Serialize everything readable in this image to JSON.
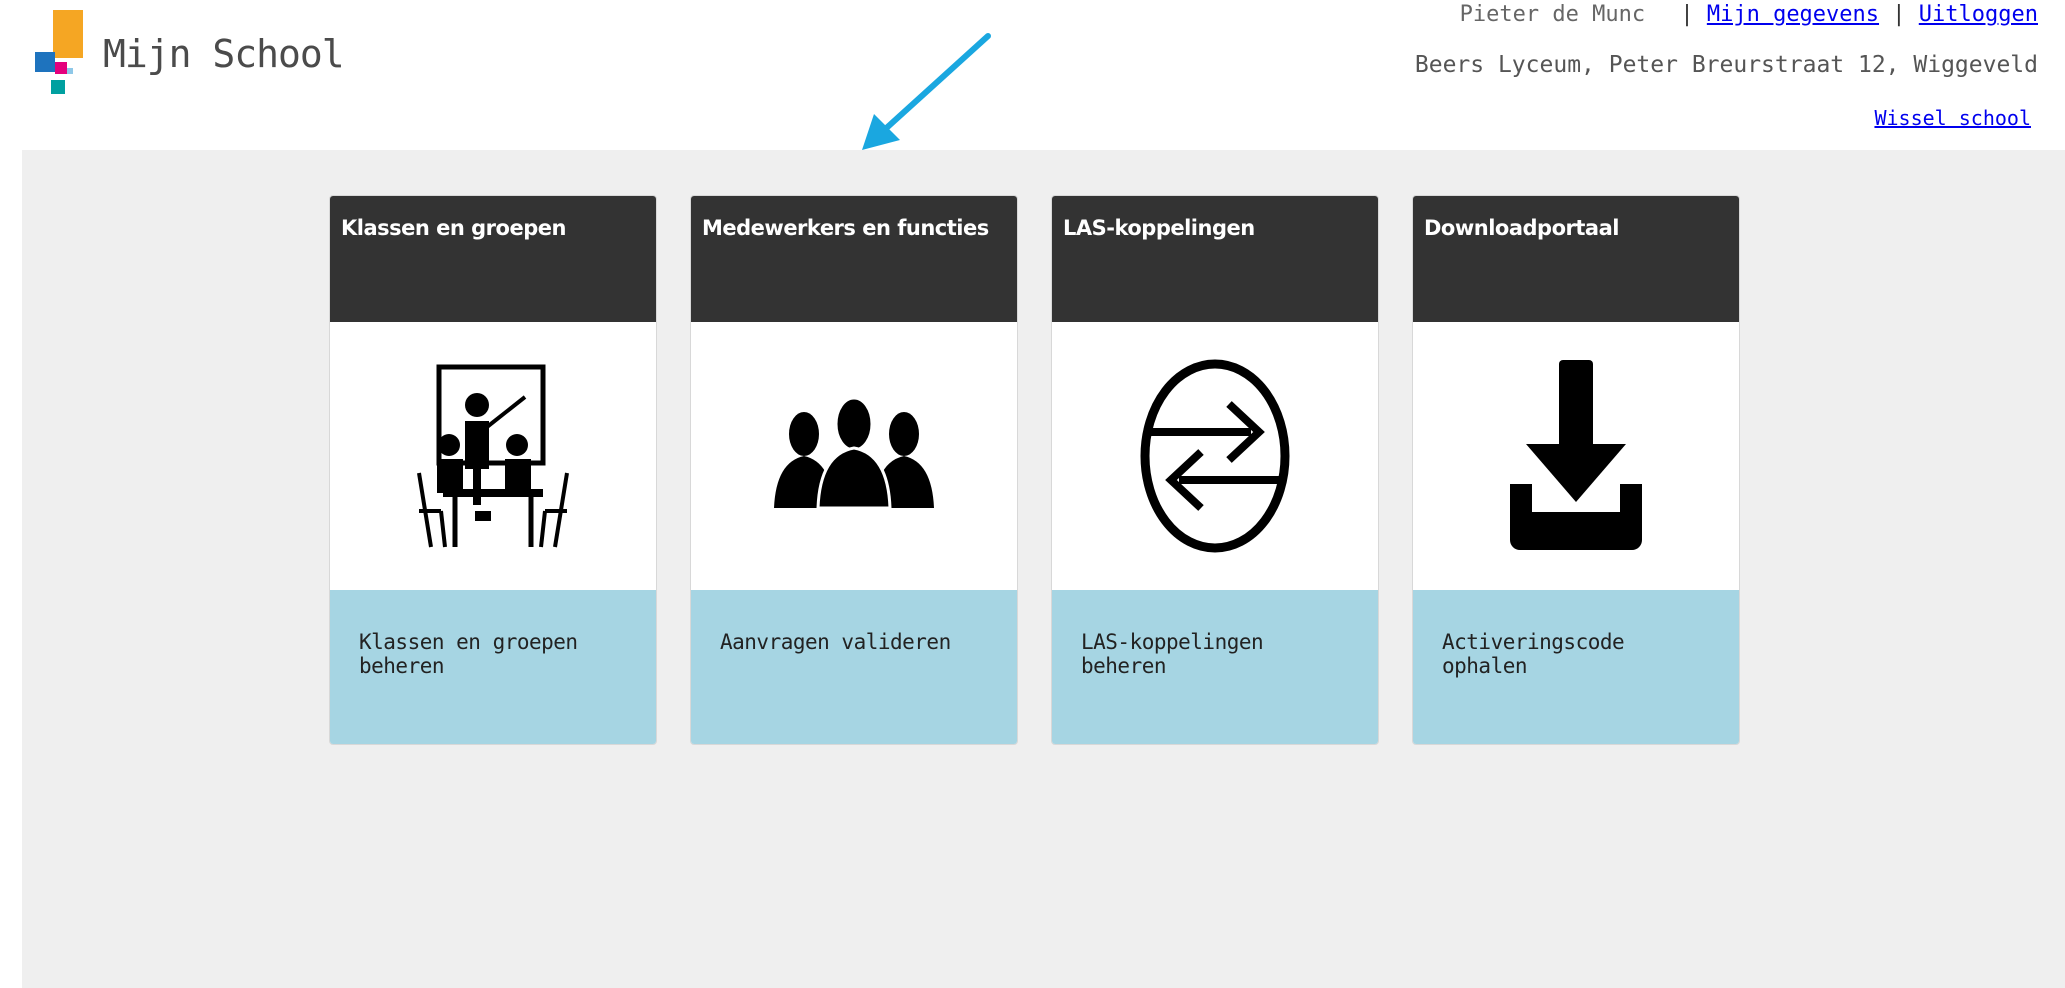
{
  "header": {
    "logo_text": "Mijn School",
    "user_name": "Pieter de Munc",
    "separator": "|",
    "my_details_link": "Mijn gegevens",
    "logout_link": "Uitloggen",
    "school_address": "Beers Lyceum, Peter Breurstraat 12, Wiggeveld",
    "switch_school_link": "Wissel school"
  },
  "tiles": [
    {
      "title": "Klassen en groepen",
      "icon": "classroom-teacher-icon",
      "action": "Klassen en groepen beheren"
    },
    {
      "title": "Medewerkers en functies",
      "icon": "staff-group-icon",
      "action": "Aanvragen valideren"
    },
    {
      "title": "LAS-koppelingen",
      "icon": "exchange-arrows-icon",
      "action": "LAS-koppelingen beheren"
    },
    {
      "title": "Downloadportaal",
      "icon": "download-icon",
      "action": "Activeringscode ophalen"
    }
  ],
  "colors": {
    "tile_header": "#333333",
    "tile_footer": "#a6d5e3",
    "background": "#efefef",
    "annotation_arrow": "#1aa7e0",
    "logo_orange": "#f5a623",
    "logo_blue": "#1e73be",
    "logo_pink": "#e4007c",
    "logo_teal": "#00a0a0"
  }
}
